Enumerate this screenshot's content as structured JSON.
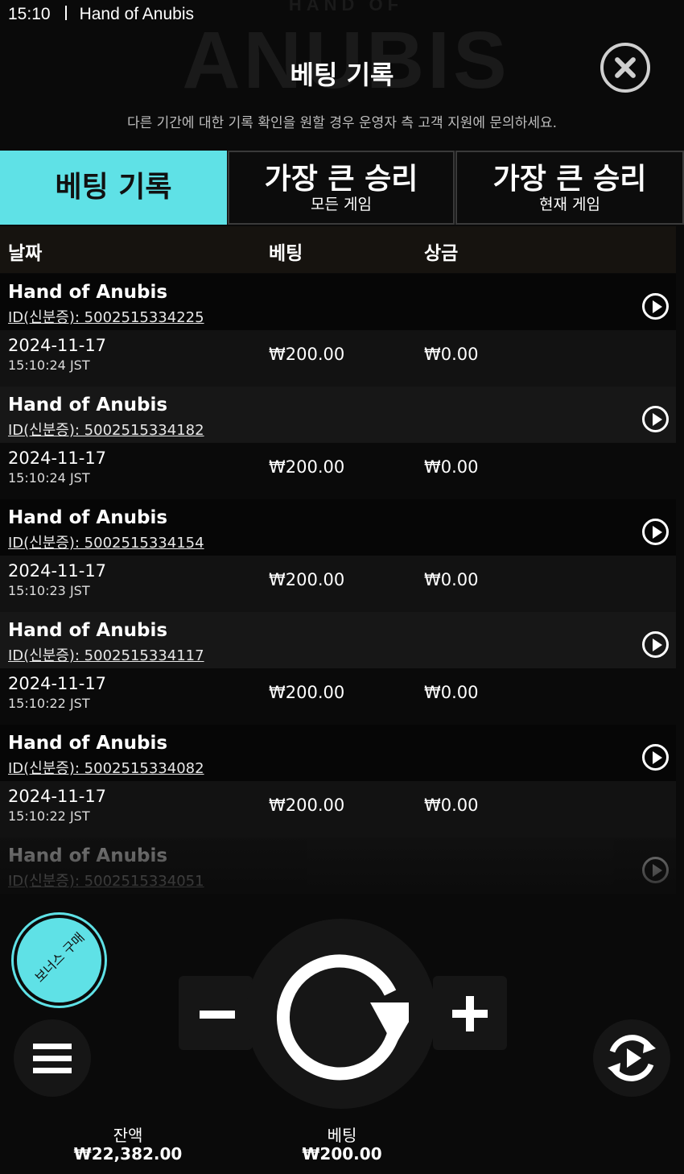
{
  "status_bar": {
    "time": "15:10",
    "app_name": "Hand of Anubis"
  },
  "background_logo": {
    "top": "HAND OF",
    "main": "ANUBIS"
  },
  "header": {
    "title": "베팅 기록",
    "subtitle": "다른 기간에 대한 기록 확인을 원할 경우 운영자 측 고객 지원에 문의하세요.",
    "close_icon": "close-icon"
  },
  "tabs": [
    {
      "label": "베팅 기록",
      "sub": "",
      "active": true
    },
    {
      "label": "가장 큰 승리",
      "sub": "모든 게임",
      "active": false
    },
    {
      "label": "가장 큰 승리",
      "sub": "현재 게임",
      "active": false
    }
  ],
  "table": {
    "headers": {
      "date": "날짜",
      "bet": "베팅",
      "win": "상금"
    },
    "rows": [
      {
        "game": "Hand of Anubis",
        "id": "ID(신분증): 5002515334225",
        "date": "2024-11-17",
        "time": "15:10:24 JST",
        "bet": "₩200.00",
        "win": "₩0.00"
      },
      {
        "game": "Hand of Anubis",
        "id": "ID(신분증): 5002515334182",
        "date": "2024-11-17",
        "time": "15:10:24 JST",
        "bet": "₩200.00",
        "win": "₩0.00"
      },
      {
        "game": "Hand of Anubis",
        "id": "ID(신분증): 5002515334154",
        "date": "2024-11-17",
        "time": "15:10:23 JST",
        "bet": "₩200.00",
        "win": "₩0.00"
      },
      {
        "game": "Hand of Anubis",
        "id": "ID(신분증): 5002515334117",
        "date": "2024-11-17",
        "time": "15:10:22 JST",
        "bet": "₩200.00",
        "win": "₩0.00"
      },
      {
        "game": "Hand of Anubis",
        "id": "ID(신분증): 5002515334082",
        "date": "2024-11-17",
        "time": "15:10:22 JST",
        "bet": "₩200.00",
        "win": "₩0.00"
      },
      {
        "game": "Hand of Anubis",
        "id": "ID(신분증): 5002515334051"
      }
    ],
    "play_icon": "play-icon"
  },
  "controls": {
    "bonus_buy": "보너스 구매",
    "menu_icon": "menu-icon",
    "spin_icon": "spin-icon",
    "minus_icon": "minus-icon",
    "plus_icon": "plus-icon",
    "autoplay_icon": "autoplay-icon"
  },
  "footer": {
    "balance_label": "잔액",
    "balance_value": "₩22,382.00",
    "bet_label": "베팅",
    "bet_value": "₩200.00"
  },
  "colors": {
    "accent": "#5fe1e6",
    "background": "#0a0a0a",
    "panel": "#161616"
  }
}
